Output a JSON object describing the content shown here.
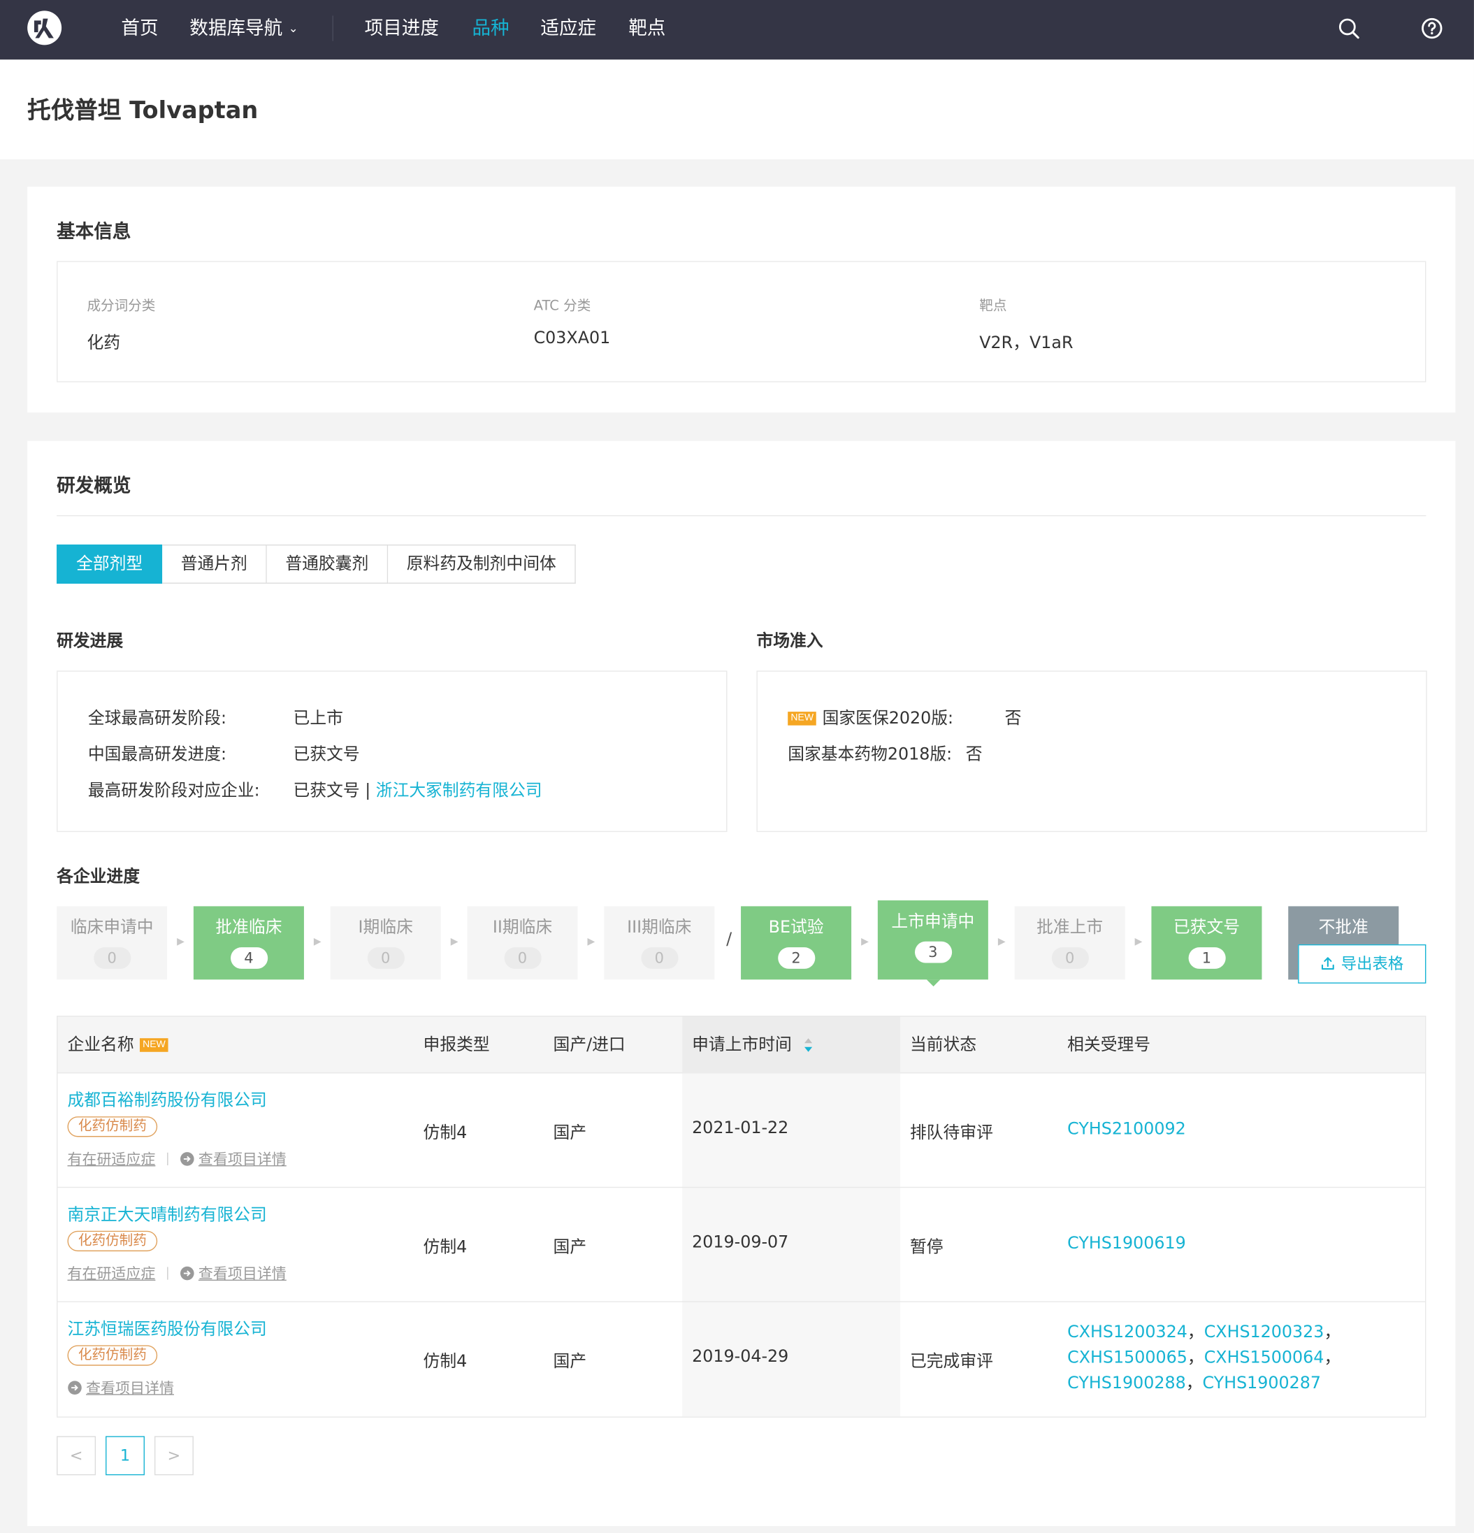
{
  "nav": {
    "items": [
      "首页",
      "数据库导航",
      "项目进度",
      "品种",
      "适应症",
      "靶点"
    ],
    "active_index": 3,
    "search_icon": "search-icon",
    "help_icon": "help-icon"
  },
  "page": {
    "title": "托伐普坦 Tolvaptan"
  },
  "basic_info": {
    "title": "基本信息",
    "fields": [
      {
        "label": "成分词分类",
        "value": "化药"
      },
      {
        "label": "ATC 分类",
        "value": "C03XA01"
      },
      {
        "label": "靶点",
        "value": "V2R，V1aR"
      }
    ]
  },
  "rd_overview": {
    "title": "研发概览",
    "tabs": [
      "全部剂型",
      "普通片剂",
      "普通胶囊剂",
      "原料药及制剂中间体"
    ],
    "active_tab": 0,
    "progress": {
      "title": "研发进展",
      "rows": [
        {
          "label": "全球最高研发阶段:",
          "value": "已上市"
        },
        {
          "label": "中国最高研发进度:",
          "value": "已获文号"
        },
        {
          "label": "最高研发阶段对应企业:",
          "value": "已获文号 | ",
          "link": "浙江大冢制药有限公司"
        }
      ]
    },
    "market": {
      "title": "市场准入",
      "new_badge": "NEW",
      "rows": [
        {
          "label": "国家医保2020版:",
          "value": "否"
        },
        {
          "label": "国家基本药物2018版:",
          "value": "否"
        }
      ]
    },
    "company_progress": {
      "title": "各企业进度",
      "stages": [
        {
          "label": "临床申请中",
          "count": "0"
        },
        {
          "label": "批准临床",
          "count": "4"
        },
        {
          "label": "I期临床",
          "count": "0"
        },
        {
          "label": "II期临床",
          "count": "0"
        },
        {
          "label": "III期临床",
          "count": "0"
        },
        {
          "label": "BE试验",
          "count": "2"
        },
        {
          "label": "上市申请中",
          "count": "3"
        },
        {
          "label": "批准上市",
          "count": "0"
        },
        {
          "label": "已获文号",
          "count": "1"
        },
        {
          "label": "不批准",
          "count": ""
        }
      ],
      "separator": "/",
      "export_label": "导出表格"
    },
    "table": {
      "headers": [
        "企业名称",
        "申报类型",
        "国产/进口",
        "申请上市时间",
        "当前状态",
        "相关受理号"
      ],
      "header_badge": "NEW",
      "rows": [
        {
          "company": "成都百裕制药股份有限公司",
          "tag": "化药仿制药",
          "link1": "有在研适应症",
          "link2": "查看项目详情",
          "type": "仿制4",
          "origin": "国产",
          "date": "2021-01-22",
          "status": "排队待审评",
          "receipts": [
            "CYHS2100092"
          ]
        },
        {
          "company": "南京正大天晴制药有限公司",
          "tag": "化药仿制药",
          "link1": "有在研适应症",
          "link2": "查看项目详情",
          "type": "仿制4",
          "origin": "国产",
          "date": "2019-09-07",
          "status": "暂停",
          "receipts": [
            "CYHS1900619"
          ]
        },
        {
          "company": "江苏恒瑞医药股份有限公司",
          "tag": "化药仿制药",
          "link1": "",
          "link2": "查看项目详情",
          "type": "仿制4",
          "origin": "国产",
          "date": "2019-04-29",
          "status": "已完成审评",
          "receipts": [
            "CXHS1200324",
            "CXHS1200323",
            "CXHS1500065",
            "CXHS1500064",
            "CYHS1900288",
            "CYHS1900287"
          ]
        }
      ]
    },
    "pagination": {
      "prev": "<",
      "current": "1",
      "next": ">"
    }
  },
  "colors": {
    "accent": "#16b3d3",
    "nav_bg": "#343545",
    "stage_green": "#7fcb84",
    "stage_gray": "#8c9aa2",
    "tag_orange": "#e0a25e",
    "new_badge": "#f5a623"
  }
}
